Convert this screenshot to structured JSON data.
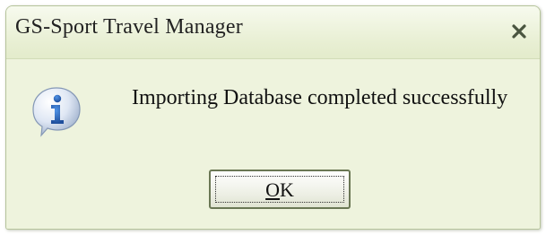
{
  "window": {
    "title": "GS-Sport Travel Manager",
    "close_glyph": "x",
    "close_icon": "close-icon"
  },
  "dialog": {
    "icon": "information-icon",
    "message": "Importing Database completed successfully",
    "ok_button": {
      "accelerator": "O",
      "rest": "K"
    }
  },
  "colors": {
    "dialog_background": "#eef3dd",
    "title_gradient_top": "#f7faee",
    "border": "#b6c49b",
    "icon_blue": "#2f6fc7"
  }
}
